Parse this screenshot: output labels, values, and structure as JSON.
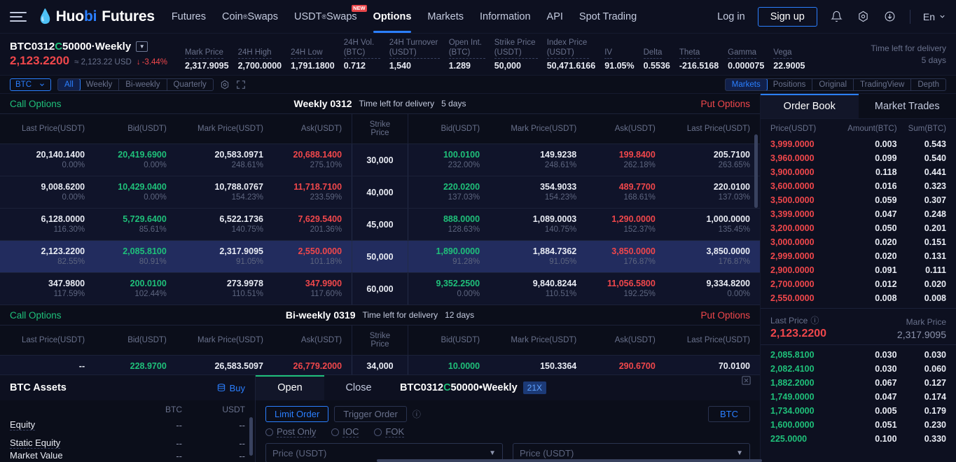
{
  "nav": {
    "brand": {
      "huo": "Huo",
      "bi": "bi",
      "futures": "Futures"
    },
    "items": [
      {
        "label": "Futures",
        "sup": "",
        "new": false,
        "active": false
      },
      {
        "label": "Coin",
        "sup": "®",
        "suffix": " Swaps",
        "new": false,
        "active": false
      },
      {
        "label": "USDT",
        "sup": "®",
        "suffix": " Swaps",
        "new": true,
        "new_label": "NEW",
        "active": false
      },
      {
        "label": "Options",
        "sup": "",
        "new": false,
        "active": true
      },
      {
        "label": "Markets",
        "sup": "",
        "new": false,
        "active": false
      },
      {
        "label": "Information",
        "sup": "",
        "new": false,
        "active": false
      },
      {
        "label": "API",
        "sup": "",
        "new": false,
        "active": false
      },
      {
        "label": "Spot Trading",
        "sup": "",
        "new": false,
        "active": false
      }
    ],
    "login": "Log in",
    "signup": "Sign up",
    "lang": "En"
  },
  "ticker": {
    "symbol_a": "BTC0312",
    "symbol_c": "C",
    "symbol_b": "50000·Weekly",
    "last_price": "2,123.2200",
    "approx": "≈ 2,123.22 USD",
    "change": "-3.44%",
    "stats": [
      {
        "label": "Mark Price",
        "value": "2,317.9095"
      },
      {
        "label": "24H High",
        "value": "2,700.0000"
      },
      {
        "label": "24H Low",
        "value": "1,791.1800"
      },
      {
        "label": "24H Vol. (BTC)",
        "value": "0.712"
      },
      {
        "label": "24H Turnover (USDT)",
        "value": "1,540"
      },
      {
        "label": "Open Int. (BTC)",
        "value": "1.289"
      },
      {
        "label": "Strike Price (USDT)",
        "value": "50,000"
      },
      {
        "label": "Index Price (USDT)",
        "value": "50,471.6166"
      },
      {
        "label": "IV",
        "value": "91.05%"
      },
      {
        "label": "Delta",
        "value": "0.5536"
      },
      {
        "label": "Theta",
        "value": "-216.5168"
      },
      {
        "label": "Gamma",
        "value": "0.000075"
      },
      {
        "label": "Vega",
        "value": "22.9005"
      }
    ],
    "delivery_label": "Time left for delivery",
    "delivery_value": "5 days"
  },
  "filterbar": {
    "coin": "BTC",
    "periods": [
      {
        "label": "All",
        "active": true
      },
      {
        "label": "Weekly",
        "active": false
      },
      {
        "label": "Bi-weekly",
        "active": false
      },
      {
        "label": "Quarterly",
        "active": false
      }
    ],
    "views": [
      {
        "label": "Markets",
        "active": true
      },
      {
        "label": "Positions",
        "active": false
      },
      {
        "label": "Original",
        "active": false
      },
      {
        "label": "TradingView",
        "active": false
      },
      {
        "label": "Depth",
        "active": false
      }
    ]
  },
  "options_table": {
    "call_label": "Call Options",
    "put_label": "Put Options",
    "delivery_label": "Time left for delivery",
    "headers": [
      "Last Price(USDT)",
      "Bid(USDT)",
      "Mark Price(USDT)",
      "Ask(USDT)",
      "Strike Price",
      "Bid(USDT)",
      "Mark Price(USDT)",
      "Ask(USDT)",
      "Last Price(USDT)"
    ],
    "sections": [
      {
        "title": "Weekly 0312",
        "delivery": "5 days",
        "rows": [
          {
            "strike": "30,000",
            "highlight": false,
            "call": [
              {
                "v": "20,140.1400",
                "p": "0.00%",
                "c": "w"
              },
              {
                "v": "20,419.6900",
                "p": "0.00%",
                "c": "g"
              },
              {
                "v": "20,583.0971",
                "p": "248.61%",
                "c": "w"
              },
              {
                "v": "20,688.1400",
                "p": "275.10%",
                "c": "r"
              }
            ],
            "put": [
              {
                "v": "100.0100",
                "p": "232.00%",
                "c": "g"
              },
              {
                "v": "149.9238",
                "p": "248.61%",
                "c": "w"
              },
              {
                "v": "199.8400",
                "p": "262.18%",
                "c": "r"
              },
              {
                "v": "205.7100",
                "p": "263.65%",
                "c": "w"
              }
            ]
          },
          {
            "strike": "40,000",
            "highlight": false,
            "call": [
              {
                "v": "9,008.6200",
                "p": "0.00%",
                "c": "w"
              },
              {
                "v": "10,429.0400",
                "p": "0.00%",
                "c": "g"
              },
              {
                "v": "10,788.0767",
                "p": "154.23%",
                "c": "w"
              },
              {
                "v": "11,718.7100",
                "p": "233.59%",
                "c": "r"
              }
            ],
            "put": [
              {
                "v": "220.0200",
                "p": "137.03%",
                "c": "g"
              },
              {
                "v": "354.9033",
                "p": "154.23%",
                "c": "w"
              },
              {
                "v": "489.7700",
                "p": "168.61%",
                "c": "r"
              },
              {
                "v": "220.0100",
                "p": "137.03%",
                "c": "w"
              }
            ]
          },
          {
            "strike": "45,000",
            "highlight": false,
            "call": [
              {
                "v": "6,128.0000",
                "p": "116.30%",
                "c": "w"
              },
              {
                "v": "5,729.6400",
                "p": "85.61%",
                "c": "g"
              },
              {
                "v": "6,522.1736",
                "p": "140.75%",
                "c": "w"
              },
              {
                "v": "7,629.5400",
                "p": "201.36%",
                "c": "r"
              }
            ],
            "put": [
              {
                "v": "888.0000",
                "p": "128.63%",
                "c": "g"
              },
              {
                "v": "1,089.0003",
                "p": "140.75%",
                "c": "w"
              },
              {
                "v": "1,290.0000",
                "p": "152.37%",
                "c": "r"
              },
              {
                "v": "1,000.0000",
                "p": "135.45%",
                "c": "w"
              }
            ]
          },
          {
            "strike": "50,000",
            "highlight": true,
            "call": [
              {
                "v": "2,123.2200",
                "p": "82.55%",
                "c": "w"
              },
              {
                "v": "2,085.8100",
                "p": "80.91%",
                "c": "g"
              },
              {
                "v": "2,317.9095",
                "p": "91.05%",
                "c": "w"
              },
              {
                "v": "2,550.0000",
                "p": "101.18%",
                "c": "r"
              }
            ],
            "put": [
              {
                "v": "1,890.0000",
                "p": "91.28%",
                "c": "g"
              },
              {
                "v": "1,884.7362",
                "p": "91.05%",
                "c": "w"
              },
              {
                "v": "3,850.0000",
                "p": "176.87%",
                "c": "r"
              },
              {
                "v": "3,850.0000",
                "p": "176.87%",
                "c": "w"
              }
            ]
          },
          {
            "strike": "60,000",
            "highlight": false,
            "call": [
              {
                "v": "347.9800",
                "p": "117.59%",
                "c": "w"
              },
              {
                "v": "200.0100",
                "p": "102.44%",
                "c": "g"
              },
              {
                "v": "273.9978",
                "p": "110.51%",
                "c": "w"
              },
              {
                "v": "347.9900",
                "p": "117.60%",
                "c": "r"
              }
            ],
            "put": [
              {
                "v": "9,352.2500",
                "p": "0.00%",
                "c": "g"
              },
              {
                "v": "9,840.8244",
                "p": "110.51%",
                "c": "w"
              },
              {
                "v": "11,056.5800",
                "p": "192.25%",
                "c": "r"
              },
              {
                "v": "9,334.8200",
                "p": "0.00%",
                "c": "w"
              }
            ]
          }
        ]
      },
      {
        "title": "Bi-weekly 0319",
        "delivery": "12 days",
        "rows": [
          {
            "strike": "34,000",
            "highlight": false,
            "call": [
              {
                "v": "--",
                "p": "",
                "c": "w"
              },
              {
                "v": "228.9700",
                "p": "",
                "c": "g"
              },
              {
                "v": "26,583.5097",
                "p": "",
                "c": "w"
              },
              {
                "v": "26,779.2000",
                "p": "",
                "c": "r"
              }
            ],
            "put": [
              {
                "v": "10.0000",
                "p": "",
                "c": "g"
              },
              {
                "v": "150.3364",
                "p": "",
                "c": "w"
              },
              {
                "v": "290.6700",
                "p": "",
                "c": "r"
              },
              {
                "v": "70.0100",
                "p": "",
                "c": "w"
              }
            ]
          }
        ]
      }
    ]
  },
  "orderbook": {
    "tabs": [
      {
        "label": "Order Book",
        "active": true
      },
      {
        "label": "Market Trades",
        "active": false
      }
    ],
    "headers": [
      "Price(USDT)",
      "Amount(BTC)",
      "Sum(BTC)"
    ],
    "asks": [
      {
        "price": "3,999.0000",
        "amount": "0.003",
        "sum": "0.543"
      },
      {
        "price": "3,960.0000",
        "amount": "0.099",
        "sum": "0.540"
      },
      {
        "price": "3,900.0000",
        "amount": "0.118",
        "sum": "0.441"
      },
      {
        "price": "3,600.0000",
        "amount": "0.016",
        "sum": "0.323"
      },
      {
        "price": "3,500.0000",
        "amount": "0.059",
        "sum": "0.307"
      },
      {
        "price": "3,399.0000",
        "amount": "0.047",
        "sum": "0.248"
      },
      {
        "price": "3,200.0000",
        "amount": "0.050",
        "sum": "0.201"
      },
      {
        "price": "3,000.0000",
        "amount": "0.020",
        "sum": "0.151"
      },
      {
        "price": "2,999.0000",
        "amount": "0.020",
        "sum": "0.131"
      },
      {
        "price": "2,900.0000",
        "amount": "0.091",
        "sum": "0.111"
      },
      {
        "price": "2,700.0000",
        "amount": "0.012",
        "sum": "0.020"
      },
      {
        "price": "2,550.0000",
        "amount": "0.008",
        "sum": "0.008"
      }
    ],
    "mid": {
      "last_label": "Last Price",
      "last_value": "2,123.2200",
      "mark_label": "Mark Price",
      "mark_value": "2,317.9095"
    },
    "bids": [
      {
        "price": "2,085.8100",
        "amount": "0.030",
        "sum": "0.030"
      },
      {
        "price": "2,082.4100",
        "amount": "0.030",
        "sum": "0.060"
      },
      {
        "price": "1,882.2000",
        "amount": "0.067",
        "sum": "0.127"
      },
      {
        "price": "1,749.0000",
        "amount": "0.047",
        "sum": "0.174"
      },
      {
        "price": "1,734.0000",
        "amount": "0.005",
        "sum": "0.179"
      },
      {
        "price": "1,600.0000",
        "amount": "0.051",
        "sum": "0.230"
      },
      {
        "price": "225.0000",
        "amount": "0.100",
        "sum": "0.330"
      }
    ]
  },
  "assets": {
    "title": "BTC Assets",
    "buy": "Buy",
    "cols": [
      "",
      "BTC",
      "USDT"
    ],
    "rows": [
      {
        "label": "Equity",
        "btc": "--",
        "usdt": "--"
      },
      {
        "label": "Static Equity",
        "btc": "--",
        "usdt": "--"
      },
      {
        "label": "Market Value",
        "btc": "--",
        "usdt": "--"
      }
    ]
  },
  "order_panel": {
    "tabs": [
      {
        "label": "Open",
        "active": true
      },
      {
        "label": "Close",
        "active": false
      }
    ],
    "symbol_a": "BTC0312",
    "symbol_c": "C",
    "symbol_b": "50000•Weekly",
    "leverage": "21X",
    "order_types": [
      {
        "label": "Limit Order",
        "active": true
      },
      {
        "label": "Trigger Order",
        "active": false
      }
    ],
    "flags": [
      "Post Only",
      "IOC",
      "FOK"
    ],
    "unit": "BTC",
    "price_placeholder": "Price (USDT)",
    "price_placeholder_2": "Price (USDT)"
  }
}
